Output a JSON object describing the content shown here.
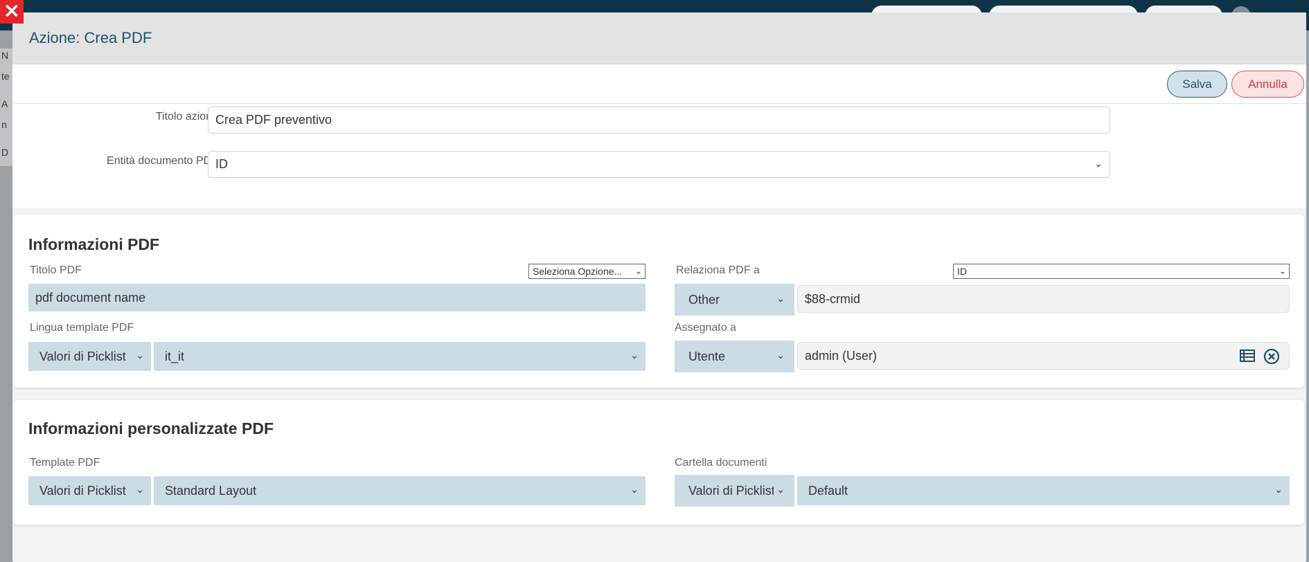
{
  "modal": {
    "title": "Azione: Crea PDF",
    "save_label": "Salva",
    "cancel_label": "Annulla"
  },
  "background": {
    "letters": [
      "N",
      "te",
      "A",
      "n",
      "D"
    ]
  },
  "action": {
    "title_label": "Titolo azione",
    "title_value": "Crea PDF preventivo",
    "entity_label": "Entità documento PDF",
    "entity_value": "ID"
  },
  "pdf_info": {
    "section_title": "Informazioni PDF",
    "pdf_title_label": "Titolo PDF",
    "pdf_title_option": "Seleziona Opzione...",
    "pdf_title_value": "pdf document name",
    "relate_label": "Relaziona PDF a",
    "relate_select": "ID",
    "relate_type": "Other",
    "relate_value": "$88-crmid",
    "lang_label": "Lingua template PDF",
    "lang_type": "Valori di Picklist",
    "lang_value": "it_it",
    "assigned_label": "Assegnato a",
    "assigned_type": "Utente",
    "assigned_value": "admin (User)"
  },
  "pdf_custom": {
    "section_title": "Informazioni personalizzate PDF",
    "template_label": "Template PDF",
    "template_type": "Valori di Picklist",
    "template_value": "Standard Layout",
    "folder_label": "Cartella documenti",
    "folder_type": "Valori di Picklist",
    "folder_value": "Default"
  },
  "icons": {
    "close": "close-icon",
    "chevron": "chevron-down-icon",
    "list": "list-icon",
    "clear": "clear-circle-icon"
  },
  "colors": {
    "accent_blue": "#21506b",
    "danger": "#e3262b",
    "field_blue": "#ccdce4"
  }
}
